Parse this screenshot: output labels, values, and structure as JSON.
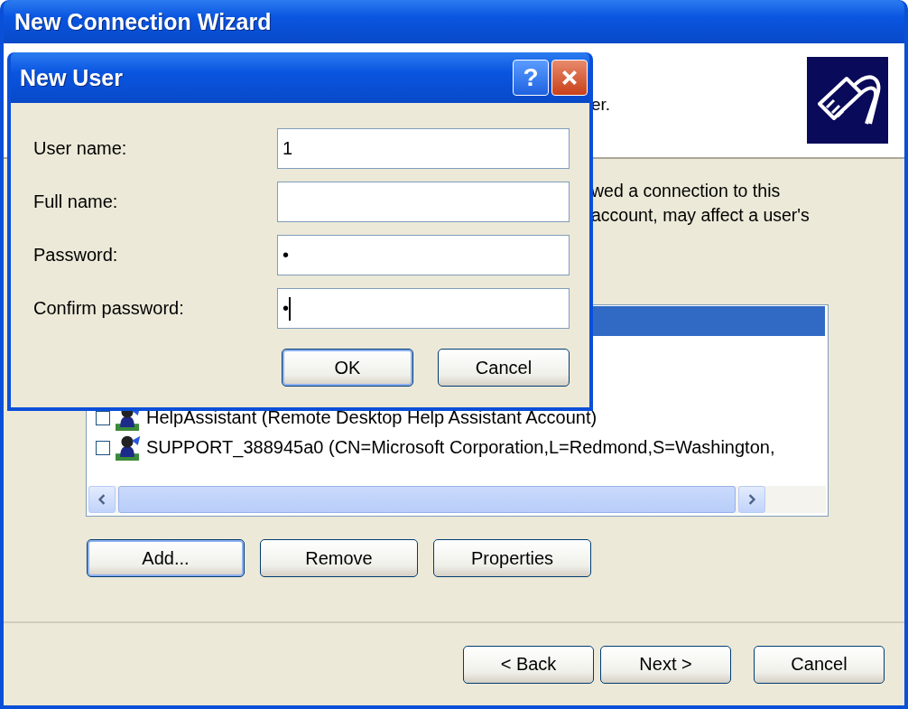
{
  "wizard": {
    "title": "New Connection Wizard",
    "header_text": "er.",
    "body_lines": [
      "wed a connection to this",
      "account, may affect a user's"
    ],
    "users": [
      {
        "selected": true
      },
      {
        "label": "HelpAssistant (Remote Desktop Help Assistant Account)",
        "checked": false,
        "selected": false
      },
      {
        "label": "SUPPORT_388945a0 (CN=Microsoft Corporation,L=Redmond,S=Washington,",
        "checked": false,
        "selected": false
      }
    ],
    "list_buttons": [
      {
        "label": "Add...",
        "default": true
      },
      {
        "label": "Remove",
        "default": false
      },
      {
        "label": "Properties",
        "default": false
      }
    ],
    "nav_buttons": [
      {
        "label": "< Back"
      },
      {
        "label": "Next >"
      },
      {
        "label": "Cancel"
      }
    ]
  },
  "dialog": {
    "title": "New User",
    "help_button": "?",
    "fields": [
      {
        "label": "User name:",
        "value": "1"
      },
      {
        "label": "Full name:"
      },
      {
        "label": "Password:",
        "value": "•"
      },
      {
        "label": "Confirm password:",
        "value": "•",
        "focused": true
      }
    ],
    "buttons": [
      {
        "label": "OK",
        "default": true
      },
      {
        "label": "Cancel",
        "default": false
      }
    ]
  }
}
